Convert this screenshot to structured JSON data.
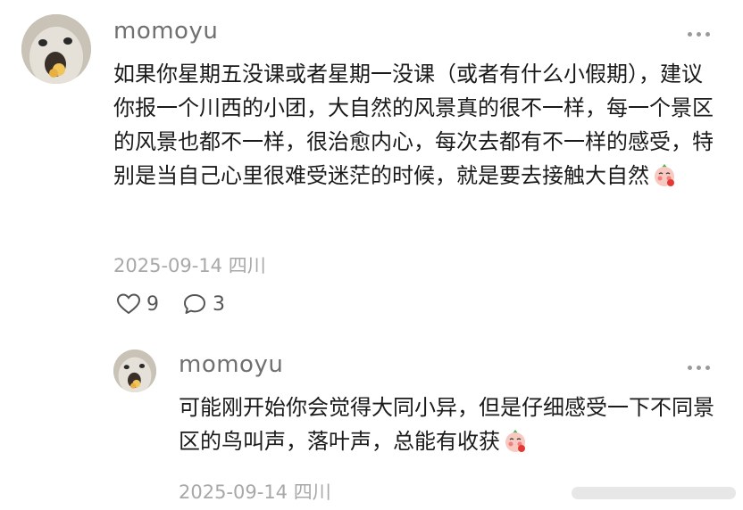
{
  "comment": {
    "username": "momoyu",
    "text": "如果你星期五没课或者星期一没课（或者有什么小假期），建议你报一个川西的小团，大自然的风景真的很不一样，每一个景区的风景也都不一样，很治愈内心，每次去都有不一样的感受，特别是当自己心里很难受迷茫的时候，就是要去接触大自然",
    "date": "2025-09-14",
    "location": "四川",
    "likes": "9",
    "replies": "3",
    "emoji_icon": "shy-face-emoji-icon"
  },
  "reply": {
    "username": "momoyu",
    "text": "可能刚开始你会觉得大同小异，但是仔细感受一下不同景区的鸟叫声，落叶声，总能有收获",
    "date": "2025-09-14",
    "location": "四川",
    "emoji_icon": "shy-face-emoji-icon"
  },
  "icons": {
    "like": "heart-icon",
    "comment": "speech-bubble-icon",
    "more": "more-dots-icon"
  }
}
